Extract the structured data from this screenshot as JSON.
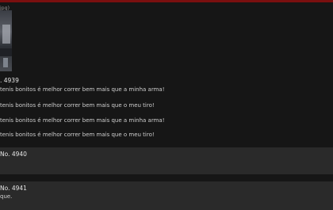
{
  "image_caption": "jpg)",
  "posts": [
    {
      "number": ". 4939",
      "lines": [
        "tenis bonitos é melhor correr bem mais que a minha arma!",
        "tenis bonitos é melhor correr bem mais que o meu tiro!",
        "tenis bonitos é melhor correr bem mais que a minha arma!",
        "tenis bonitos é melhor correr bem mais que o meu tiro!"
      ]
    },
    {
      "number": "No. 4940"
    },
    {
      "number": "No. 4941",
      "lines": [
        "que."
      ]
    }
  ],
  "colors": {
    "accent": "#7a0f0f",
    "background": "#161616",
    "card": "#2a2a2a"
  }
}
